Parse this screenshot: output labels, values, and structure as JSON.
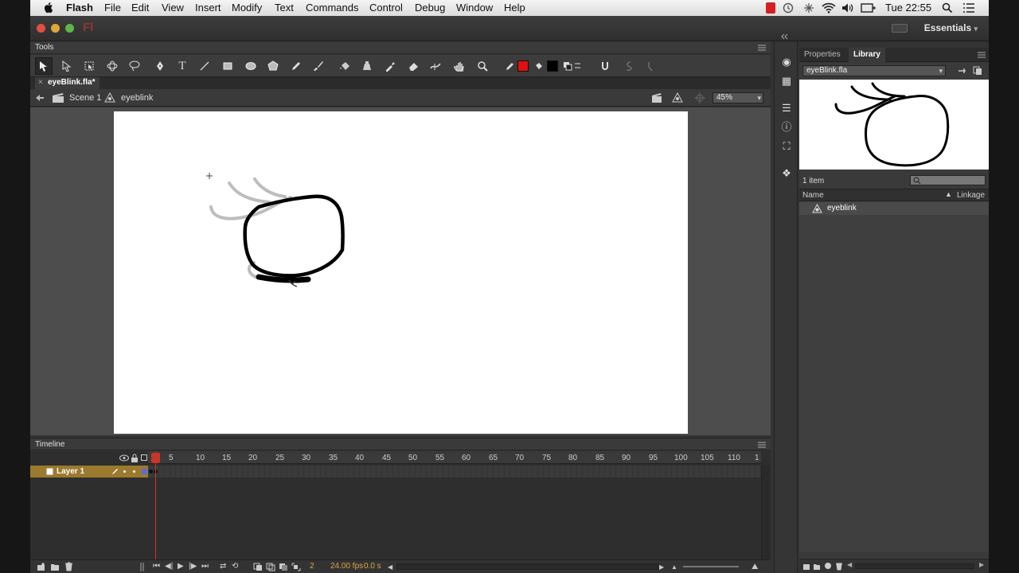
{
  "menubar": {
    "app_name": "Flash",
    "menus": [
      "File",
      "Edit",
      "View",
      "Insert",
      "Modify",
      "Text",
      "Commands",
      "Control",
      "Debug",
      "Window",
      "Help"
    ],
    "clock": "Tue 22:55"
  },
  "titlebar": {
    "logo": "Fl",
    "workspace": "Essentials",
    "workspace_arrow": "▾"
  },
  "tools_panel": {
    "title": "Tools",
    "tools": [
      "selection-tool",
      "subselection-tool",
      "free-transform-tool",
      "3d-rotation-tool",
      "lasso-tool",
      "pen-tool",
      "text-tool",
      "line-tool",
      "rectangle-tool",
      "oval-tool",
      "polystar-tool",
      "pencil-tool",
      "brush-tool",
      "paint-bucket-tool",
      "ink-bottle-tool",
      "eyedropper-tool",
      "eraser-tool",
      "width-tool",
      "hand-tool",
      "zoom-tool"
    ],
    "stroke_color": "#e01010",
    "fill_color": "#000000"
  },
  "document": {
    "tab_label": "eyeBlink.fla*",
    "tab_close": "×"
  },
  "editbar": {
    "scene": "Scene 1",
    "symbol": "eyeblink",
    "zoom": "45%",
    "zoom_arrow": "▾"
  },
  "stage": {
    "background": "#ffffff",
    "drawing": "eye-with-eyelashes"
  },
  "timeline": {
    "title": "Timeline",
    "ticks": [
      "5",
      "10",
      "15",
      "20",
      "25",
      "30",
      "35",
      "40",
      "45",
      "50",
      "55",
      "60",
      "65",
      "70",
      "75",
      "80",
      "85",
      "90",
      "95",
      "100",
      "105",
      "110",
      "1"
    ],
    "layer_name": "Layer 1",
    "current_frame": "2",
    "fps": "24.00 fps",
    "time": "0.0 s"
  },
  "library": {
    "tabs": [
      "Properties",
      "Library"
    ],
    "active_tab": "Library",
    "document": "eyeBlink.fla",
    "document_arrow": "▾",
    "item_count": "1 item",
    "columns": {
      "name": "Name",
      "linkage": "Linkage"
    },
    "items": [
      {
        "name": "eyeblink",
        "type": "movie-clip"
      }
    ]
  }
}
